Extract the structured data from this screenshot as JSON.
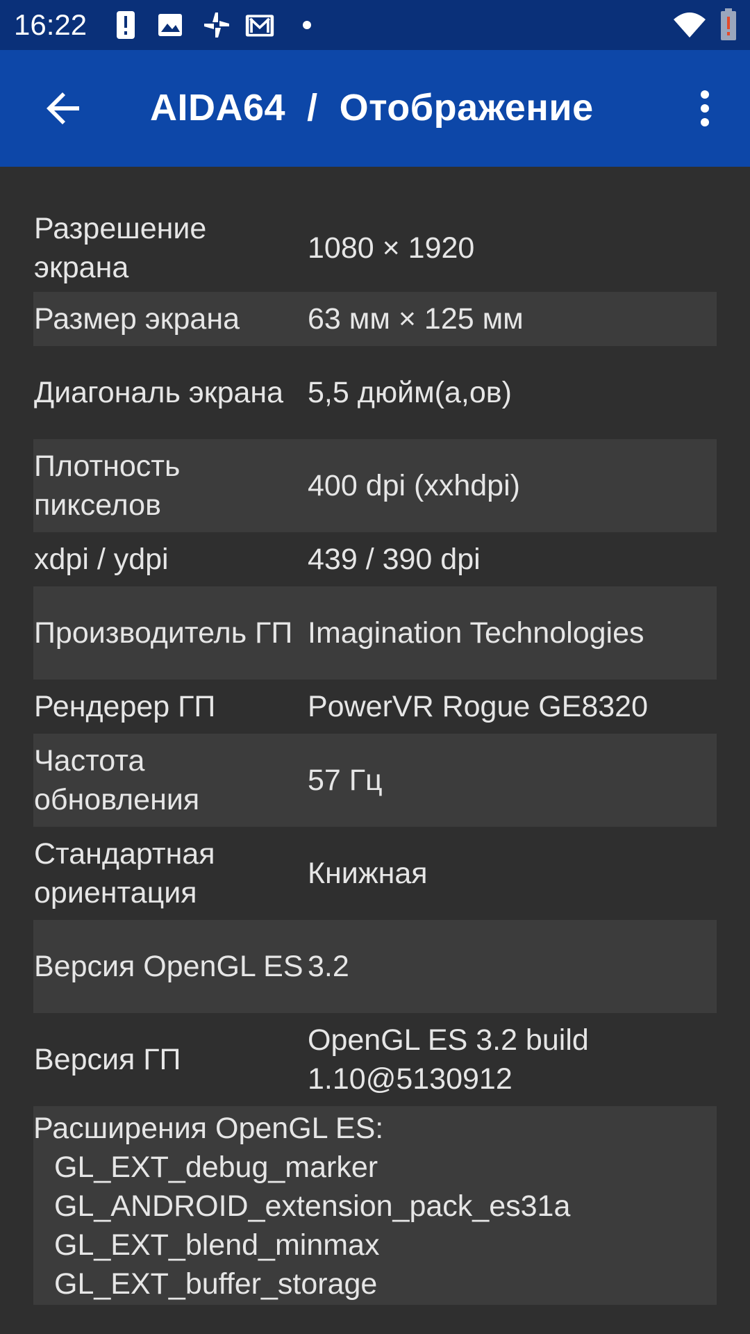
{
  "status_bar": {
    "time": "16:22",
    "icons": [
      "alert-icon",
      "image-icon",
      "pinwheel-icon",
      "gmail-icon",
      "dot-icon"
    ],
    "right_icons": [
      "wifi-icon",
      "battery-alert-icon"
    ]
  },
  "app_bar": {
    "back_icon": "arrow-back-icon",
    "title": "AIDA64  /  Отображение",
    "menu_icon": "more-vert-icon"
  },
  "rows": [
    {
      "label": "Разрешение экрана",
      "value": "1080 × 1920"
    },
    {
      "label": "Размер экрана",
      "value": "63 мм × 125 мм"
    },
    {
      "label": "Диагональ экрана",
      "value": "5,5 дюйм(а,ов)"
    },
    {
      "label": "Плотность пикселов",
      "value": "400 dpi (xxhdpi)"
    },
    {
      "label": "xdpi / ydpi",
      "value": "439 / 390 dpi"
    },
    {
      "label": "Производитель ГП",
      "value": "Imagination Technologies"
    },
    {
      "label": "Рендерер ГП",
      "value": "PowerVR Rogue GE8320"
    },
    {
      "label": "Частота обновления",
      "value": "57 Гц"
    },
    {
      "label": "Стандартная ориентация",
      "value": "Книжная"
    },
    {
      "label": "Версия OpenGL ES",
      "value": "3.2"
    },
    {
      "label": "Версия ГП",
      "value": "OpenGL ES 3.2 build 1.10@5130912"
    }
  ],
  "extensions": {
    "title": "Расширения OpenGL ES:",
    "items": [
      "GL_EXT_debug_marker",
      "GL_ANDROID_extension_pack_es31a",
      "GL_EXT_blend_minmax",
      "GL_EXT_buffer_storage"
    ]
  },
  "colors": {
    "status_bar": "#0a3079",
    "app_bar": "#0d47a8",
    "background": "#2f2f2f",
    "alt_row": "#3c3c3c",
    "text": "#e6e6e6"
  }
}
